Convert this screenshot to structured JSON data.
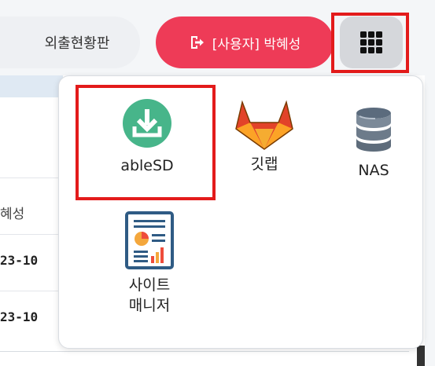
{
  "header": {
    "status_board_label": "외출현황판",
    "user_label": "[사용자] 박혜성"
  },
  "background": {
    "name_fragment": "혜성",
    "row1_fragment": "23-10",
    "row2_fragment": "23-10"
  },
  "apps": [
    {
      "label": "ableSD",
      "icon": "download-icon"
    },
    {
      "label": "깃랩",
      "icon": "gitlab-icon"
    },
    {
      "label": "NAS",
      "icon": "database-icon"
    },
    {
      "label": "사이트\n매니저",
      "icon": "report-chart-icon"
    }
  ],
  "colors": {
    "user_button": "#ee3b57",
    "highlight": "#e31b1b",
    "download_green": "#47b58a"
  }
}
